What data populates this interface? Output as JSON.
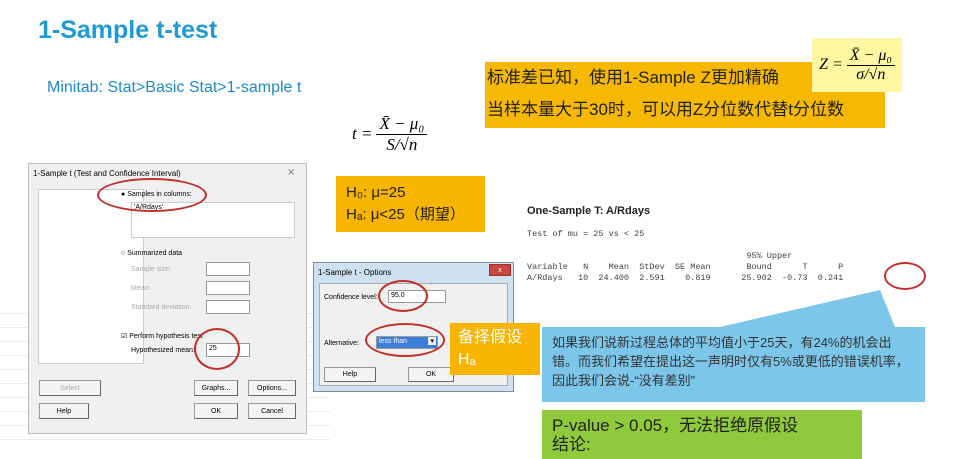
{
  "slide": {
    "title": "1-Sample t-test",
    "menu_path": "Minitab: Stat>Basic Stat>1-sample t",
    "t_formula": {
      "lhs": "t =",
      "num": "X̄ − μ₀",
      "den": "S/√n"
    },
    "z_formula": {
      "lhs": "Z =",
      "num": "X̄ − μ₀",
      "den": "σ/√n"
    },
    "z_note": [
      "标准差已知，使用1-Sample Z更加精确",
      "当样本量大于30时，可以用Z分位数代替t分位数"
    ],
    "hypotheses": [
      "H₀: μ=25",
      "Hₐ: μ<25（期望）"
    ],
    "ha_label": [
      "备择假设",
      "Hₐ"
    ],
    "explanation": "如果我们说新过程总体的平均值小于25天，有24%的机会出错。而我们希望在提出这一声明时仅有5%或更低的错误机率，因此我们会说-“没有差别”",
    "conclusion": [
      "P-value > 0.05，无法拒绝原假设",
      "结论:"
    ]
  },
  "dialog_main": {
    "title": "1-Sample t (Test and Confidence Interval)",
    "close": "⨯",
    "samples_in_columns": "Samples in columns:",
    "columns_value": "'A/Rdays'",
    "summarized": "Summarized data",
    "sample_size": "Sample size:",
    "mean": "Mean:",
    "std": "Standard deviation:",
    "perform_test": "Perform hypothesis test",
    "hyp_mean_label": "Hypothesized mean:",
    "hyp_mean_value": "25",
    "buttons": {
      "select": "Select",
      "help": "Help",
      "graphs": "Graphs...",
      "options": "Options...",
      "ok": "OK",
      "cancel": "Cancel"
    }
  },
  "dialog_options": {
    "title": "1-Sample t - Options",
    "close": "x",
    "conf_label": "Confidence level:",
    "conf_value": "95.0",
    "alt_label": "Alternative:",
    "alt_value": "less than",
    "buttons": {
      "help": "Help",
      "ok": "OK"
    }
  },
  "output": {
    "heading": "One-Sample T: A/Rdays",
    "test_line": "Test of mu = 25 vs < 25",
    "header1": "                                           95% Upper",
    "header2": "Variable   N    Mean  StDev  SE Mean       Bound      T      P",
    "row": "A/Rdays   10  24.400  2.591    0.819      25.902  -0.73  0.241"
  },
  "colors": {
    "title": "#1e9ad6",
    "orange": "#f6b800",
    "blue": "#7cc6ea",
    "green": "#8fca3c",
    "circle": "#c0302c"
  }
}
